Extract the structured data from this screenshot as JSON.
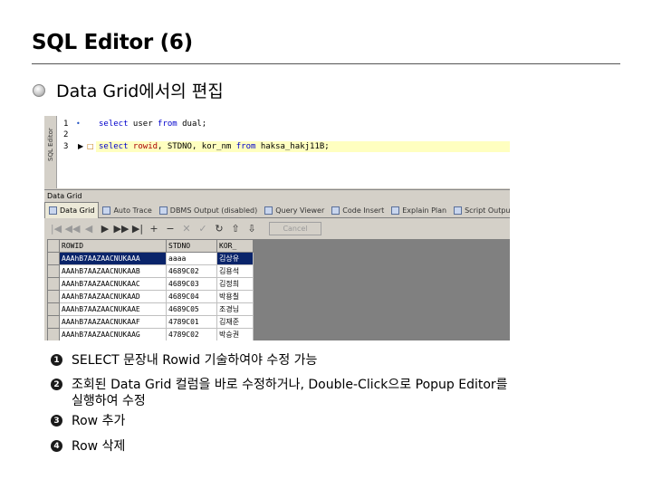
{
  "slide": {
    "title": "SQL Editor (6)",
    "bullet": "Data Grid에서의 편집"
  },
  "screenshot": {
    "side_tab": "SQL Editor",
    "editor": {
      "line_numbers": [
        "1",
        "2",
        "3"
      ],
      "line1": {
        "kw1": "select",
        "mid": " user ",
        "kw2": "from",
        "tail": " dual;"
      },
      "line3": {
        "kw1": "select",
        "fn": " rowid",
        "rest": ", STDNO, kor_nm ",
        "kw2": "from",
        "tail": " haksa_hakj11B;"
      }
    },
    "grid_title": "Data Grid",
    "tabs": [
      "Data Grid",
      "Auto Trace",
      "DBMS Output (disabled)",
      "Query Viewer",
      "Code Insert",
      "Explain Plan",
      "Script Output"
    ],
    "toolbar": {
      "icons": [
        "first-icon",
        "prev-page-icon",
        "prev-icon",
        "next-icon",
        "next-page-icon",
        "last-icon",
        "add-row-icon",
        "delete-row-icon",
        "cancel-edit-icon",
        "post-icon",
        "refresh-icon",
        "export-icon",
        "import-icon"
      ],
      "cancel_label": "Cancel"
    },
    "table": {
      "columns": [
        "ROWID",
        "STDNO",
        "KOR_"
      ],
      "rows": [
        [
          "AAAhB7AAZAACNUKAAA",
          "aaaa",
          "김상유"
        ],
        [
          "AAAhB7AAZAACNUKAAB",
          "4689C02",
          "김용석"
        ],
        [
          "AAAhB7AAZAACNUKAAC",
          "4689C03",
          "김정희"
        ],
        [
          "AAAhB7AAZAACNUKAAD",
          "4689C04",
          "박용칠"
        ],
        [
          "AAAhB7AAZAACNUKAAE",
          "4689C05",
          "조경님"
        ],
        [
          "AAAhB7AAZAACNUKAAF",
          "4789C01",
          "김재준"
        ],
        [
          "AAAhB7AAZAACNUKAAG",
          "4789C02",
          "박승권"
        ]
      ]
    }
  },
  "steps": [
    {
      "num": "1",
      "text": "SELECT 문장내 Rowid 기술하여야 수정 가능"
    },
    {
      "num": "2",
      "text": "조회된 Data Grid 컬럼을 바로 수정하거나, Double-Click으로 Popup Editor를\n실행하여 수정"
    },
    {
      "num": "3",
      "text": "Row 추가"
    },
    {
      "num": "4",
      "text": "Row 삭제"
    }
  ]
}
